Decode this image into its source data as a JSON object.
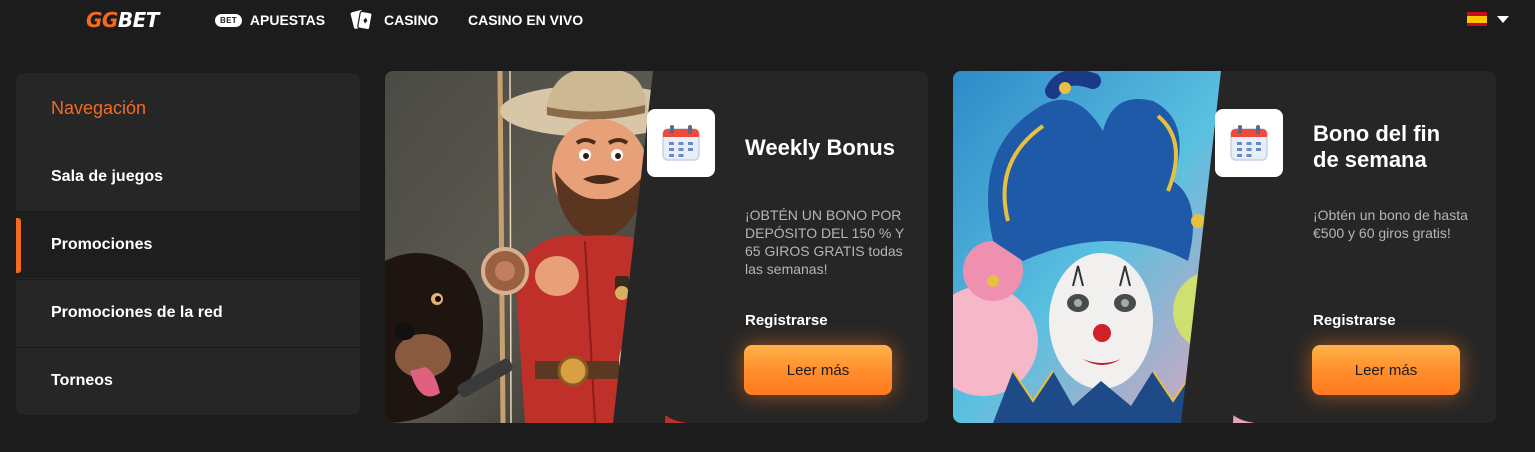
{
  "header": {
    "logo_left": "GG",
    "logo_right": "BET",
    "nav": [
      {
        "label": "APUESTAS",
        "icon": "bet-badge-icon",
        "badge": "BET"
      },
      {
        "label": "CASINO",
        "icon": "playing-cards-icon"
      },
      {
        "label": "CASINO EN VIVO"
      }
    ],
    "language_flag": "spain-flag-icon"
  },
  "sidebar": {
    "title": "Navegación",
    "items": [
      {
        "label": "Sala de juegos",
        "active": false
      },
      {
        "label": "Promociones",
        "active": true
      },
      {
        "label": "Promociones de la red",
        "active": false
      },
      {
        "label": "Torneos",
        "active": false
      }
    ]
  },
  "promos": [
    {
      "icon": "calendar-icon",
      "title": "Weekly Bonus",
      "description": "¡OBTÉN UN BONO POR DEPÓSITO DEL 150 % Y 65 GIROS GRATIS todas las semanas!",
      "register": "Registrarse",
      "button": "Leer más",
      "art": "cowboy-fisherman-with-dog-illustration"
    },
    {
      "icon": "calendar-icon",
      "title": "Bono del fin de semana",
      "description": "¡Obtén un bono de hasta €500 y 60 giros gratis!",
      "register": "Registrarse",
      "button": "Leer más",
      "art": "jester-clown-illustration"
    }
  ],
  "colors": {
    "background": "#1c1c1c",
    "panel": "#262626",
    "accent": "#f26b22",
    "button_gradient_top": "#ffb24a",
    "button_gradient_bottom": "#ff7a1f"
  }
}
